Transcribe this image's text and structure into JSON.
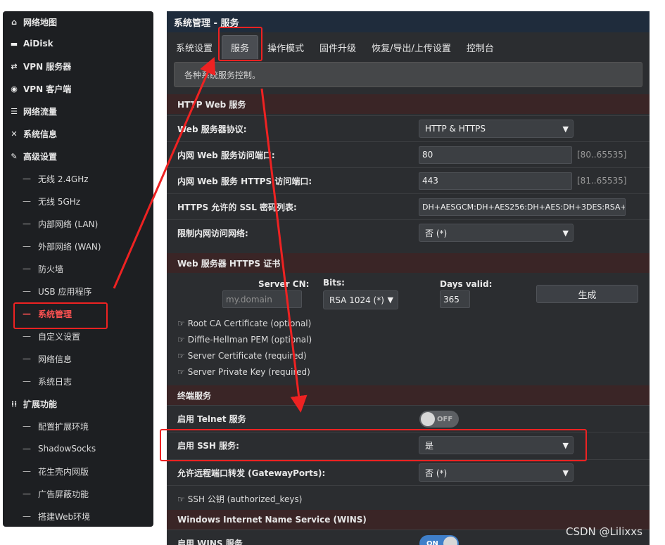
{
  "sidebar": {
    "items": [
      {
        "label": "网络地图",
        "icon": "home-icon",
        "glyph": "⌂"
      },
      {
        "label": "AiDisk",
        "icon": "disk-icon",
        "glyph": "▬"
      },
      {
        "label": "VPN 服务器",
        "icon": "swap-icon",
        "glyph": "⇄"
      },
      {
        "label": "VPN 客户端",
        "icon": "globe-icon",
        "glyph": "◉"
      },
      {
        "label": "网络流量",
        "icon": "list-icon",
        "glyph": "☰"
      },
      {
        "label": "系统信息",
        "icon": "shuffle-icon",
        "glyph": "✕"
      },
      {
        "label": "高级设置",
        "icon": "wrench-icon",
        "glyph": "✎"
      }
    ],
    "advanced": [
      "无线 2.4GHz",
      "无线 5GHz",
      "内部网络 (LAN)",
      "外部网络 (WAN)",
      "防火墙",
      "USB 应用程序",
      "系统管理",
      "自定义设置",
      "网络信息",
      "系统日志"
    ],
    "ext_label": "扩展功能",
    "ext_icon": "grid-icon",
    "ext_glyph": "⁞⁞",
    "ext": [
      "配置扩展环境",
      "ShadowSocks",
      "花生壳内网版",
      "广告屏蔽功能",
      "搭建Web环境"
    ],
    "dash": "—"
  },
  "main": {
    "title": "系统管理 - 服务",
    "tabs": [
      "系统设置",
      "服务",
      "操作模式",
      "固件升级",
      "恢复/导出/上传设置",
      "控制台"
    ],
    "info": "各种系统服务控制。"
  },
  "http": {
    "header": "HTTP Web 服务",
    "protocol_label": "Web 服务器协议:",
    "protocol_value": "HTTP & HTTPS",
    "port_label": "内网 Web 服务访问端口:",
    "port_value": "80",
    "port_hint": "[80..65535]",
    "https_port_label": "内网 Web 服务 HTTPS 访问端口:",
    "https_port_value": "443",
    "https_port_hint": "[81..65535]",
    "ssl_label": "HTTPS 允许的 SSL 密码列表:",
    "ssl_value": "DH+AESGCM:DH+AES256:DH+AES:DH+3DES:RSA+",
    "restrict_label": "限制内网访问网络:",
    "restrict_value": "否 (*)"
  },
  "cert": {
    "header": "Web 服务器 HTTPS 证书",
    "cn_label": "Server CN:",
    "cn_placeholder": "my.domain",
    "bits_label": "Bits:",
    "bits_value": "RSA 1024 (*)",
    "days_label": "Days valid:",
    "days_value": "365",
    "generate": "生成",
    "links": [
      "Root CA Certificate (optional)",
      "Diffie-Hellman PEM (optional)",
      "Server Certificate (required)",
      "Server Private Key (required)"
    ],
    "hand": "☞"
  },
  "terminal": {
    "header": "终端服务",
    "telnet_label": "启用 Telnet 服务",
    "telnet_state": "OFF",
    "ssh_label": "启用 SSH 服务:",
    "ssh_value": "是",
    "gateway_label": "允许远程端口转发 (GatewayPorts):",
    "gateway_value": "否 (*)",
    "keys_label": "SSH 公钥 (authorized_keys)"
  },
  "wins": {
    "header": "Windows Internet Name Service (WINS)",
    "enable_label": "启用 WINS 服务",
    "state": "ON"
  },
  "watermark": "CSDN @Lilixxs",
  "colors": {
    "annotation": "#ee2222",
    "active_nav": "#ff5252",
    "section": "#3a2526",
    "toggle_on": "#3f7fc9"
  }
}
